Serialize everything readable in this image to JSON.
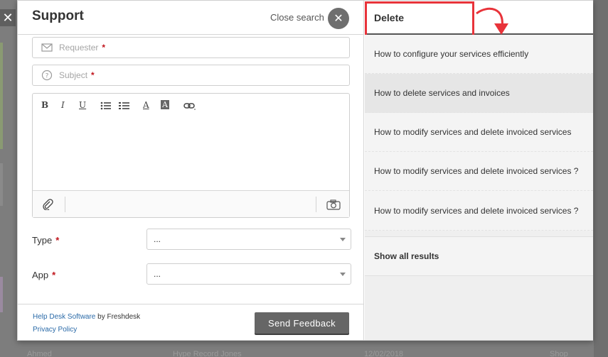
{
  "overlay": {
    "close_glyph": "✕"
  },
  "backdrop": {
    "bottom_texts": [
      "Ahmed",
      "Hype Record Jones",
      "12/02/2018",
      "Shop"
    ]
  },
  "support": {
    "title": "Support",
    "close_search_label": "Close search",
    "close_glyph": "✕",
    "requester_placeholder": "Requester",
    "subject_placeholder": "Subject",
    "required_mark": "*",
    "toolbar": {
      "bold": "B",
      "italic": "I",
      "underline": "U",
      "font_color": "A",
      "bg_color": "A"
    },
    "type_label": "Type",
    "type_value": "...",
    "app_label": "App",
    "app_value": "...",
    "footer": {
      "helpdesk_link": "Help Desk Software",
      "by_text": " by Freshdesk",
      "privacy_link": "Privacy Policy"
    },
    "send_button": "Send Feedback"
  },
  "search": {
    "query": "Delete",
    "results": [
      "How to configure your services efficiently",
      "How to delete services and invoices",
      "How to modify services and delete invoiced services",
      "How to modify services and delete invoiced services ?",
      "How to modify services and delete invoiced services ?"
    ],
    "show_all": "Show all results"
  },
  "colors": {
    "accent_red": "#e8333a",
    "link_blue": "#2a6aa8",
    "button_gray": "#666666"
  }
}
